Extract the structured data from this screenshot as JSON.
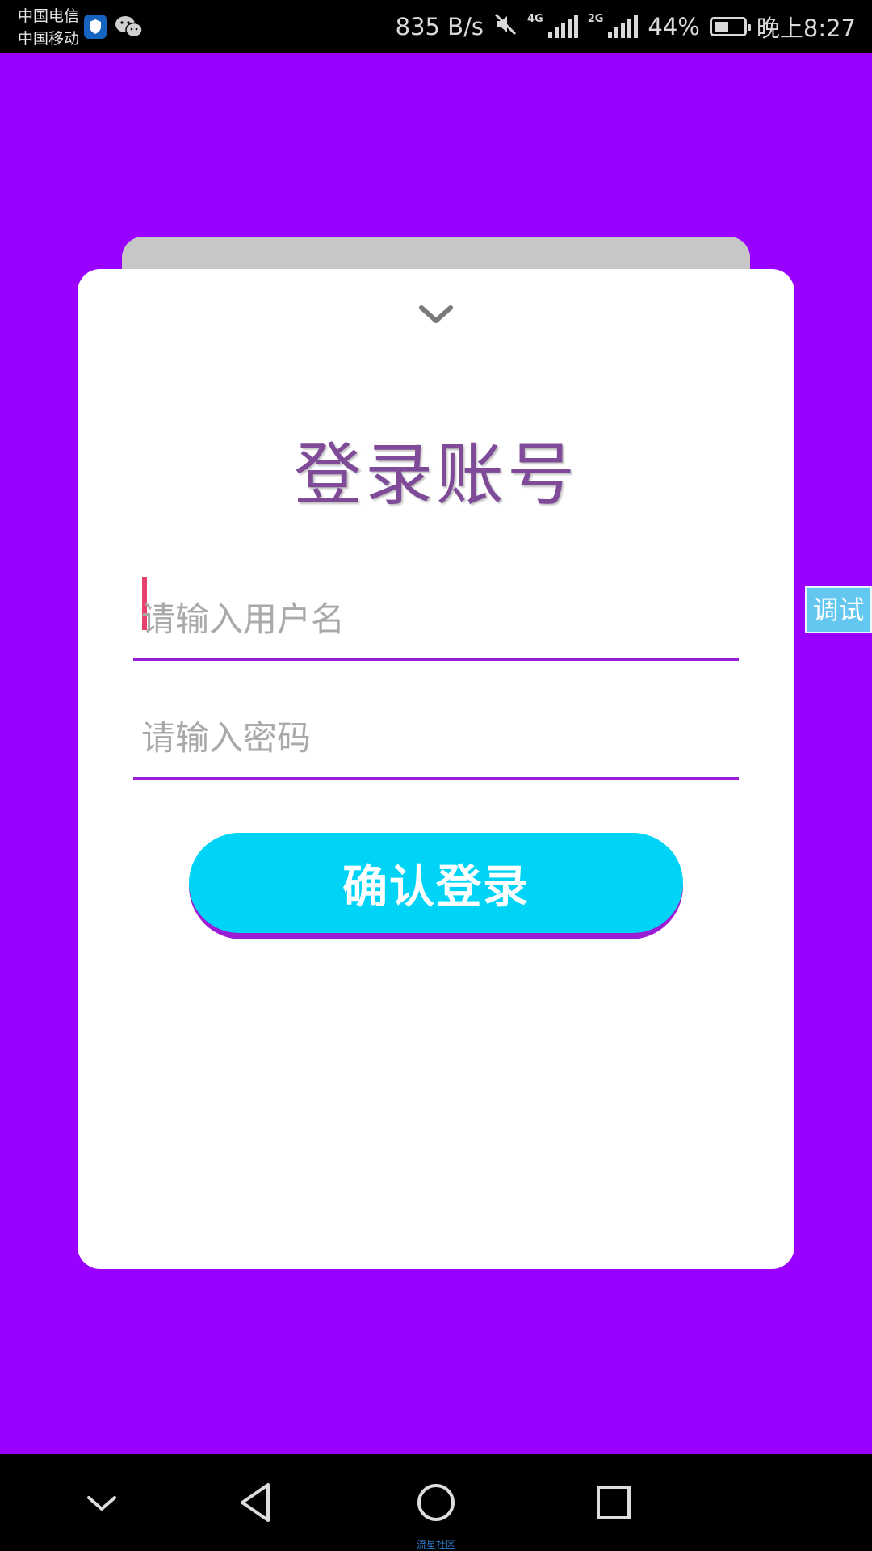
{
  "status_bar": {
    "carrier_1": "中国电信",
    "carrier_2": "中国移动",
    "net_speed": "835 B/s",
    "net_type_1": "4G",
    "net_type_2": "2G",
    "battery": "44%",
    "time": "晚上8:27",
    "icons": [
      "shield-icon",
      "wechat-icon",
      "mute-icon",
      "signal-icon",
      "battery-icon"
    ]
  },
  "login": {
    "title": "登录账号",
    "username_placeholder": "请输入用户名",
    "password_placeholder": "请输入密码",
    "submit_label": "确认登录"
  },
  "debug_tab": {
    "label": "调试"
  },
  "nav_bar": {
    "icons": [
      "chevron-down-icon",
      "back-icon",
      "home-icon",
      "recent-apps-icon"
    ]
  },
  "watermark": "流星社区",
  "colors": {
    "background": "#9900FF",
    "accent_cyan": "#00D4F6",
    "underline_purple": "#9B1DD6",
    "title_purple": "#7F4B98",
    "caret_pink": "#E8416D"
  }
}
